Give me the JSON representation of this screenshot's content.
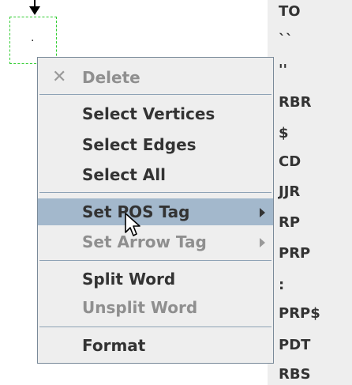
{
  "vertex": {
    "label": "."
  },
  "menu": {
    "items": [
      {
        "label": "Delete"
      },
      {
        "label": "Select Vertices"
      },
      {
        "label": "Select Edges"
      },
      {
        "label": "Select All"
      },
      {
        "label": "Set POS Tag"
      },
      {
        "label": "Set Arrow Tag"
      },
      {
        "label": "Split Word"
      },
      {
        "label": "Unsplit Word"
      },
      {
        "label": "Format"
      }
    ]
  },
  "tags": [
    "TO",
    "``",
    "''",
    "RBR",
    "$",
    "CD",
    "JJR",
    "RP",
    "PRP",
    ":",
    "PRP$",
    "PDT",
    "RBS"
  ],
  "icons": {
    "delete": "close-x-icon",
    "cursor": "mouse-pointer-icon",
    "submenu": "chevron-right-icon"
  },
  "colors": {
    "highlight": "#a3b8cc",
    "vertex_border": "#2ecc2e",
    "menu_bg": "#eeeeee"
  }
}
